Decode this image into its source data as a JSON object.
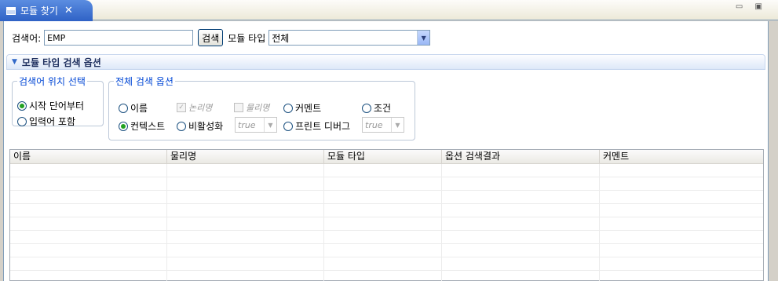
{
  "tab": {
    "title": "모듈 찾기",
    "close": "✕"
  },
  "window_controls": "▭ ▣",
  "search": {
    "label": "검색어:",
    "value": "EMP",
    "button": "검색",
    "type_label": "모듈 타입",
    "type_value": "전체"
  },
  "options_section": {
    "title": "모듈 타입 검색 옵션"
  },
  "position_group": {
    "legend": "검색어 위치 선택",
    "options": [
      {
        "label": "시작 단어부터",
        "selected": true
      },
      {
        "label": "입력어 포함",
        "selected": false
      }
    ]
  },
  "all_options_group": {
    "legend": "전체 검색 옵션",
    "name": "이름",
    "logical": "논리명",
    "physical": "물리명",
    "comment": "커멘트",
    "condition": "조건",
    "context": "컨텍스트",
    "inactive": "비활성화",
    "inactive_value": "true",
    "print_debug": "프린트 디버그",
    "print_debug_value": "true"
  },
  "table": {
    "columns": [
      "이름",
      "물리명",
      "모듈 타입",
      "옵션 검색결과",
      "커멘트"
    ],
    "rows": [
      [
        "",
        "",
        "",
        "",
        ""
      ],
      [
        "",
        "",
        "",
        "",
        ""
      ],
      [
        "",
        "",
        "",
        "",
        ""
      ],
      [
        "",
        "",
        "",
        "",
        ""
      ],
      [
        "",
        "",
        "",
        "",
        ""
      ],
      [
        "",
        "",
        "",
        "",
        ""
      ],
      [
        "",
        "",
        "",
        "",
        ""
      ],
      [
        "",
        "",
        "",
        "",
        ""
      ],
      [
        "",
        "",
        "",
        "",
        ""
      ]
    ]
  },
  "colors": {
    "tab_active": "#2f62c6",
    "legend_text": "#0046d5",
    "radio_selected": "#21a121"
  }
}
